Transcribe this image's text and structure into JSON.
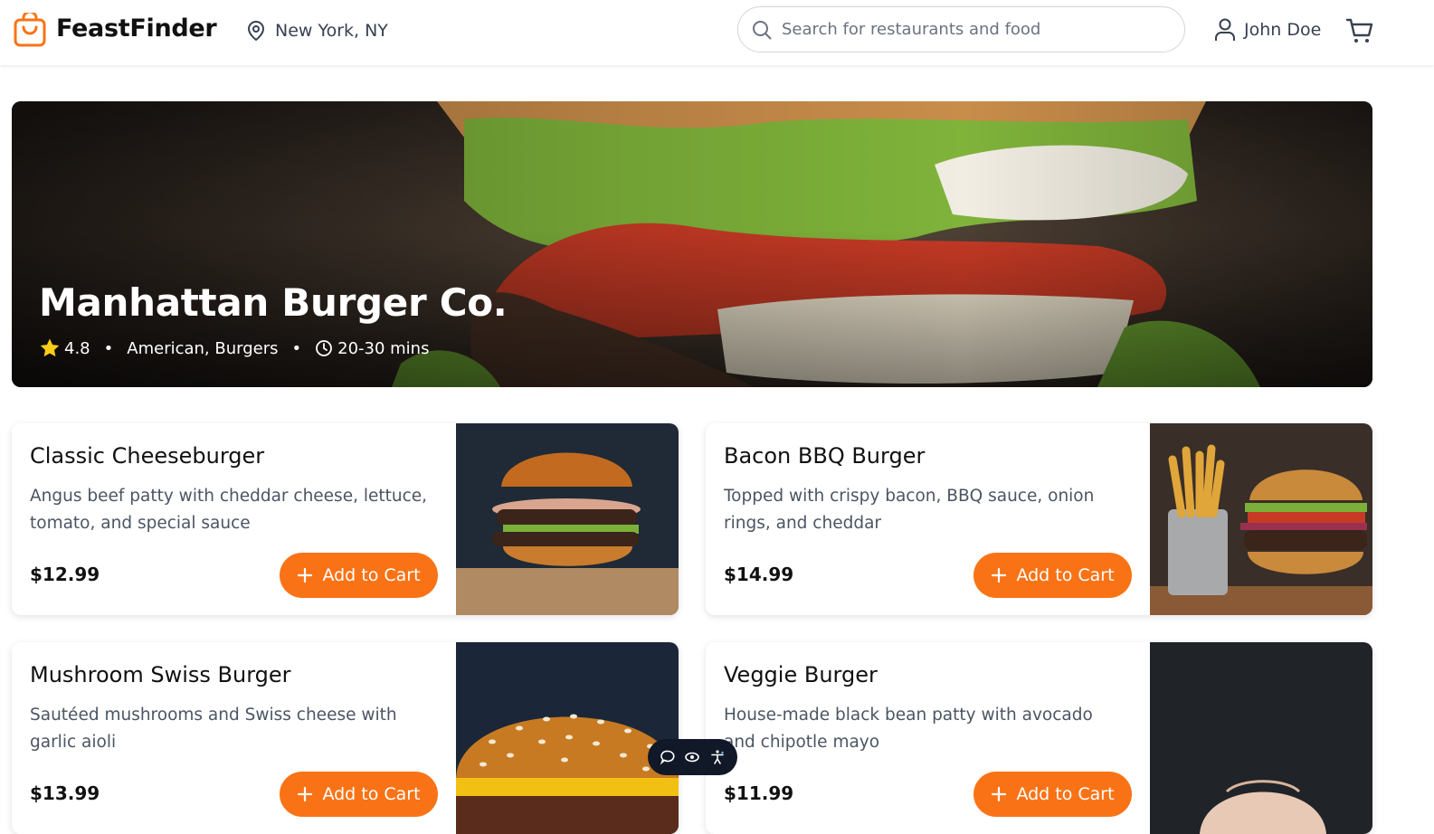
{
  "app": {
    "name": "FeastFinder",
    "accent": "#f97316"
  },
  "header": {
    "location": "New York, NY",
    "search_placeholder": "Search for restaurants and food",
    "user_name": "John Doe",
    "icons": {
      "logo": "shopping-bag-icon",
      "location": "map-pin-icon",
      "search": "search-icon",
      "user": "user-icon",
      "cart": "cart-icon"
    }
  },
  "restaurant": {
    "name": "Manhattan Burger Co.",
    "rating": "4.8",
    "cuisine": "American, Burgers",
    "delivery_time": "20-30 mins"
  },
  "menu": [
    {
      "name": "Classic Cheeseburger",
      "description": "Angus beef patty with cheddar cheese, lettuce, tomato, and special sauce",
      "price": "$12.99",
      "button": "Add to Cart"
    },
    {
      "name": "Bacon BBQ Burger",
      "description": "Topped with crispy bacon, BBQ sauce, onion rings, and cheddar",
      "price": "$14.99",
      "button": "Add to Cart"
    },
    {
      "name": "Mushroom Swiss Burger",
      "description": "Sautéed mushrooms and Swiss cheese with garlic aioli",
      "price": "$13.99",
      "button": "Add to Cart"
    },
    {
      "name": "Veggie Burger",
      "description": "House-made black bean patty with avocado and chipotle mayo",
      "price": "$11.99",
      "button": "Add to Cart"
    }
  ],
  "floating_toolbar": {
    "icons": [
      "comment-icon",
      "eye-icon",
      "accessibility-icon"
    ]
  }
}
